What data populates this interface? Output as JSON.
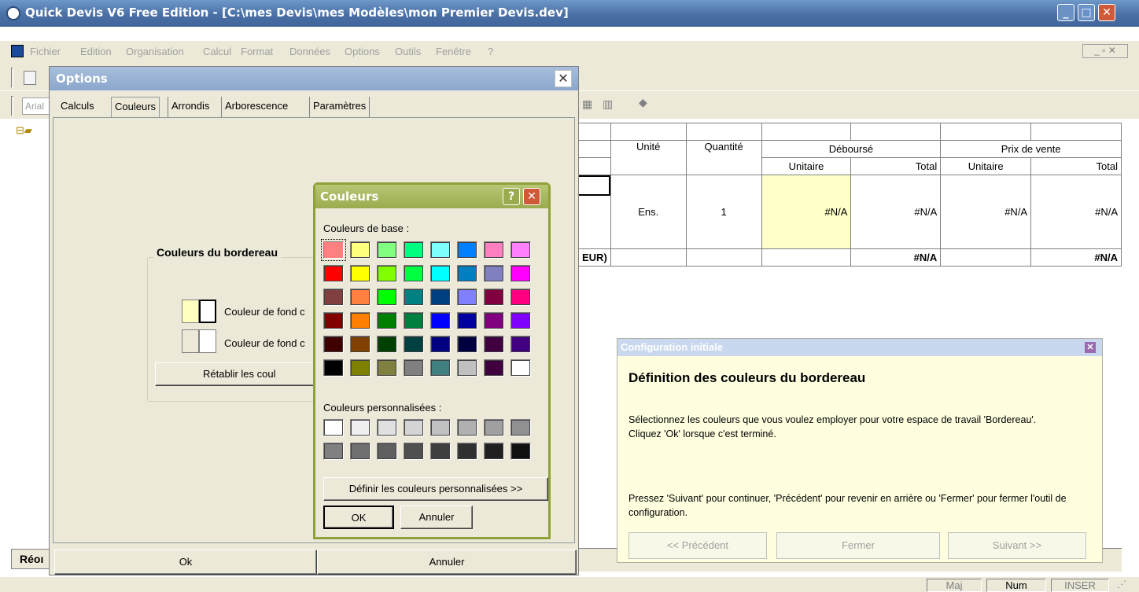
{
  "window": {
    "title": "Quick Devis V6 Free Edition - [C:\\mes Devis\\mes Modèles\\mon Premier Devis.dev]"
  },
  "menu": [
    "Fichier",
    "Edition",
    "Organisation",
    "Calcul",
    "Format",
    "Données",
    "Options",
    "Outils",
    "Fenêtre",
    "?"
  ],
  "toolbar": {
    "font_name": "Arial"
  },
  "grid": {
    "headers": {
      "unite": "Unité",
      "quantite": "Quantité",
      "debourse": "Déboursé",
      "prix_vente": "Prix de vente",
      "unitaire": "Unitaire",
      "total": "Total"
    },
    "row": {
      "unite": "Ens.",
      "quantite": "1",
      "deb_unit": "#N/A",
      "deb_total": "#N/A",
      "pv_unit": "#N/A",
      "pv_total": "#N/A"
    },
    "total_row": {
      "label": "EUR)",
      "deb_total": "#N/A",
      "pv_total": "#N/A"
    }
  },
  "options_dialog": {
    "title": "Options",
    "tabs": [
      "Calculs",
      "Couleurs",
      "Arrondis",
      "Arborescence",
      "Paramètres"
    ],
    "selected_tab": "Couleurs",
    "group_title": "Couleurs du bordereau",
    "fond1_label": "Couleur de fond c",
    "fond2_label": "Couleur de fond c",
    "reset_button": "Rétablir les coul",
    "ok_button": "Ok",
    "cancel_button": "Annuler"
  },
  "colors_dialog": {
    "title": "Couleurs",
    "base_label": "Couleurs de base :",
    "base_colors": [
      "#ff8080",
      "#ffff80",
      "#80ff80",
      "#00ff80",
      "#80ffff",
      "#0080ff",
      "#ff80c0",
      "#ff80ff",
      "#ff0000",
      "#ffff00",
      "#80ff00",
      "#00ff40",
      "#00ffff",
      "#0080c0",
      "#8080c0",
      "#ff00ff",
      "#804040",
      "#ff8040",
      "#00ff00",
      "#008080",
      "#004080",
      "#8080ff",
      "#800040",
      "#ff0080",
      "#800000",
      "#ff8000",
      "#008000",
      "#008040",
      "#0000ff",
      "#0000a0",
      "#800080",
      "#8000ff",
      "#400000",
      "#804000",
      "#004000",
      "#004040",
      "#000080",
      "#000040",
      "#400040",
      "#400080",
      "#000000",
      "#808000",
      "#808040",
      "#808080",
      "#408080",
      "#c0c0c0",
      "#400040",
      "#ffffff"
    ],
    "custom_label": "Couleurs personnalisées :",
    "custom_colors": [
      "#ffffff",
      "#f0f0f0",
      "#e0e0e0",
      "#d4d4d4",
      "#c0c0c0",
      "#b0b0b0",
      "#a0a0a0",
      "#909090",
      "#808080",
      "#707070",
      "#606060",
      "#505050",
      "#404040",
      "#303030",
      "#202020",
      "#101010"
    ],
    "define_button": "Définir les couleurs personnalisées >>",
    "ok_button": "OK",
    "cancel_button": "Annuler"
  },
  "config_panel": {
    "title": "Configuration initiale",
    "heading": "Définition des couleurs du bordereau",
    "text1": "Sélectionnez les couleurs que vous voulez employer pour votre espace de travail 'Bordereau'. Cliquez 'Ok' lorsque c'est terminé.",
    "text2": "Pressez 'Suivant' pour continuer, 'Précédent' pour revenir en arrière ou 'Fermer' pour fermer l'outil de configuration.",
    "prev_button": "<< Précédent",
    "close_button": "Fermer",
    "next_button": "Suivant >>"
  },
  "left_tab": {
    "label": "Réoı"
  },
  "status": {
    "maj": "Maj",
    "num": "Num",
    "inser": "INSER"
  }
}
